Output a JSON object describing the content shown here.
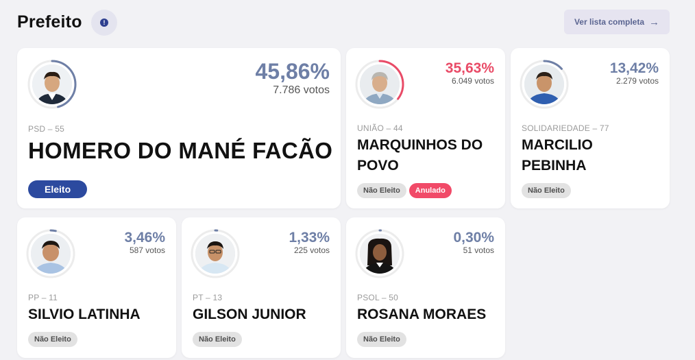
{
  "header": {
    "title": "Prefeito",
    "info_symbol": "!",
    "list_button_label": "Ver lista completa",
    "list_button_arrow": "→"
  },
  "colors": {
    "elected_blue": "#2c4a9f",
    "annulled_red": "#f14a68",
    "percent_slate": "#6e7fa6",
    "percent_red": "#e94b67"
  },
  "candidates": [
    {
      "percent": "45,86%",
      "votes": "7.786 votos",
      "party": "PSD – 55",
      "name": "HOMERO DO MANÉ FACÃO",
      "status_badges": [
        "Eleito"
      ],
      "vote_fraction": 0.4586,
      "ring_color": "#6e7fa6"
    },
    {
      "percent": "35,63%",
      "votes": "6.049 votos",
      "party": "UNIÃO – 44",
      "name": "MARQUINHOS DO POVO",
      "status_badges": [
        "Não Eleito",
        "Anulado"
      ],
      "vote_fraction": 0.3563,
      "ring_color": "#e94b67"
    },
    {
      "percent": "13,42%",
      "votes": "2.279 votos",
      "party": "SOLIDARIEDADE – 77",
      "name": "MARCILIO PEBINHA",
      "status_badges": [
        "Não Eleito"
      ],
      "vote_fraction": 0.1342,
      "ring_color": "#6e7fa6"
    },
    {
      "percent": "3,46%",
      "votes": "587 votos",
      "party": "PP – 11",
      "name": "SILVIO LATINHA",
      "status_badges": [
        "Não Eleito"
      ],
      "vote_fraction": 0.0346,
      "ring_color": "#6e7fa6"
    },
    {
      "percent": "1,33%",
      "votes": "225 votos",
      "party": "PT – 13",
      "name": "GILSON JUNIOR",
      "status_badges": [
        "Não Eleito"
      ],
      "vote_fraction": 0.0133,
      "ring_color": "#6e7fa6"
    },
    {
      "percent": "0,30%",
      "votes": "51 votos",
      "party": "PSOL – 50",
      "name": "ROSANA MORAES",
      "status_badges": [
        "Não Eleito"
      ],
      "vote_fraction": 0.003,
      "ring_color": "#6e7fa6"
    }
  ]
}
